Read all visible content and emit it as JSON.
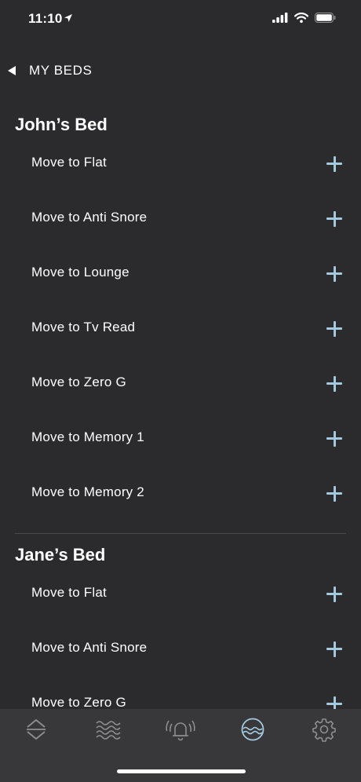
{
  "status_bar": {
    "time": "11:10"
  },
  "header": {
    "back_label": "MY BEDS"
  },
  "sections": [
    {
      "title": "John’s Bed",
      "items": [
        {
          "label": "Move to Flat"
        },
        {
          "label": "Move to Anti Snore"
        },
        {
          "label": "Move to Lounge"
        },
        {
          "label": "Move to Tv Read"
        },
        {
          "label": "Move to Zero G"
        },
        {
          "label": "Move to Memory 1"
        },
        {
          "label": "Move to Memory 2"
        }
      ]
    },
    {
      "title": "Jane’s Bed",
      "items": [
        {
          "label": "Move to Flat"
        },
        {
          "label": "Move to Anti Snore"
        },
        {
          "label": "Move to Zero G"
        }
      ]
    }
  ],
  "tab_bar": {
    "tabs": [
      {
        "icon": "position-arrows-icon"
      },
      {
        "icon": "massage-waves-icon"
      },
      {
        "icon": "alarm-bell-icon"
      },
      {
        "icon": "routines-icon",
        "active": true
      },
      {
        "icon": "settings-gear-icon"
      }
    ]
  },
  "colors": {
    "background": "#2b2b2d",
    "tab_bar": "#38383b",
    "accent_plus": "#a4c8de",
    "tab_inactive": "#8e8e92",
    "tab_active": "#a4c8de"
  }
}
